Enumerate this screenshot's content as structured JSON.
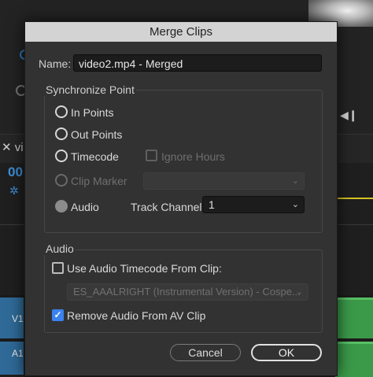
{
  "dialog": {
    "title": "Merge Clips",
    "name_label": "Name:",
    "name_value": "video2.mp4 - Merged",
    "sync_group_title": "Synchronize Point",
    "sync_options": {
      "in_points": "In Points",
      "out_points": "Out Points",
      "timecode": "Timecode",
      "ignore_hours": "Ignore Hours",
      "clip_marker": "Clip Marker",
      "audio": "Audio",
      "track_channel_label": "Track Channel",
      "track_channel_value": "1"
    },
    "selected_sync_point": "Audio",
    "audio_group_title": "Audio",
    "use_audio_timecode_label": "Use Audio Timecode From Clip:",
    "use_audio_timecode_checked": false,
    "audio_clip_value": "ES_AAALRIGHT (Instrumental Version) - Cospe...",
    "remove_audio_label": "Remove Audio From AV Clip",
    "remove_audio_checked": true,
    "cancel_label": "Cancel",
    "ok_label": "OK"
  },
  "background": {
    "panel_tab_text": "vi",
    "timecode_text": "00",
    "track_v1": "V1",
    "track_a1": "A1"
  },
  "colors": {
    "accent_blue": "#3b82f0",
    "track_blue": "#2f6a98",
    "clip_green": "#3b9a4a",
    "playhead_yellow": "#d8c224"
  }
}
